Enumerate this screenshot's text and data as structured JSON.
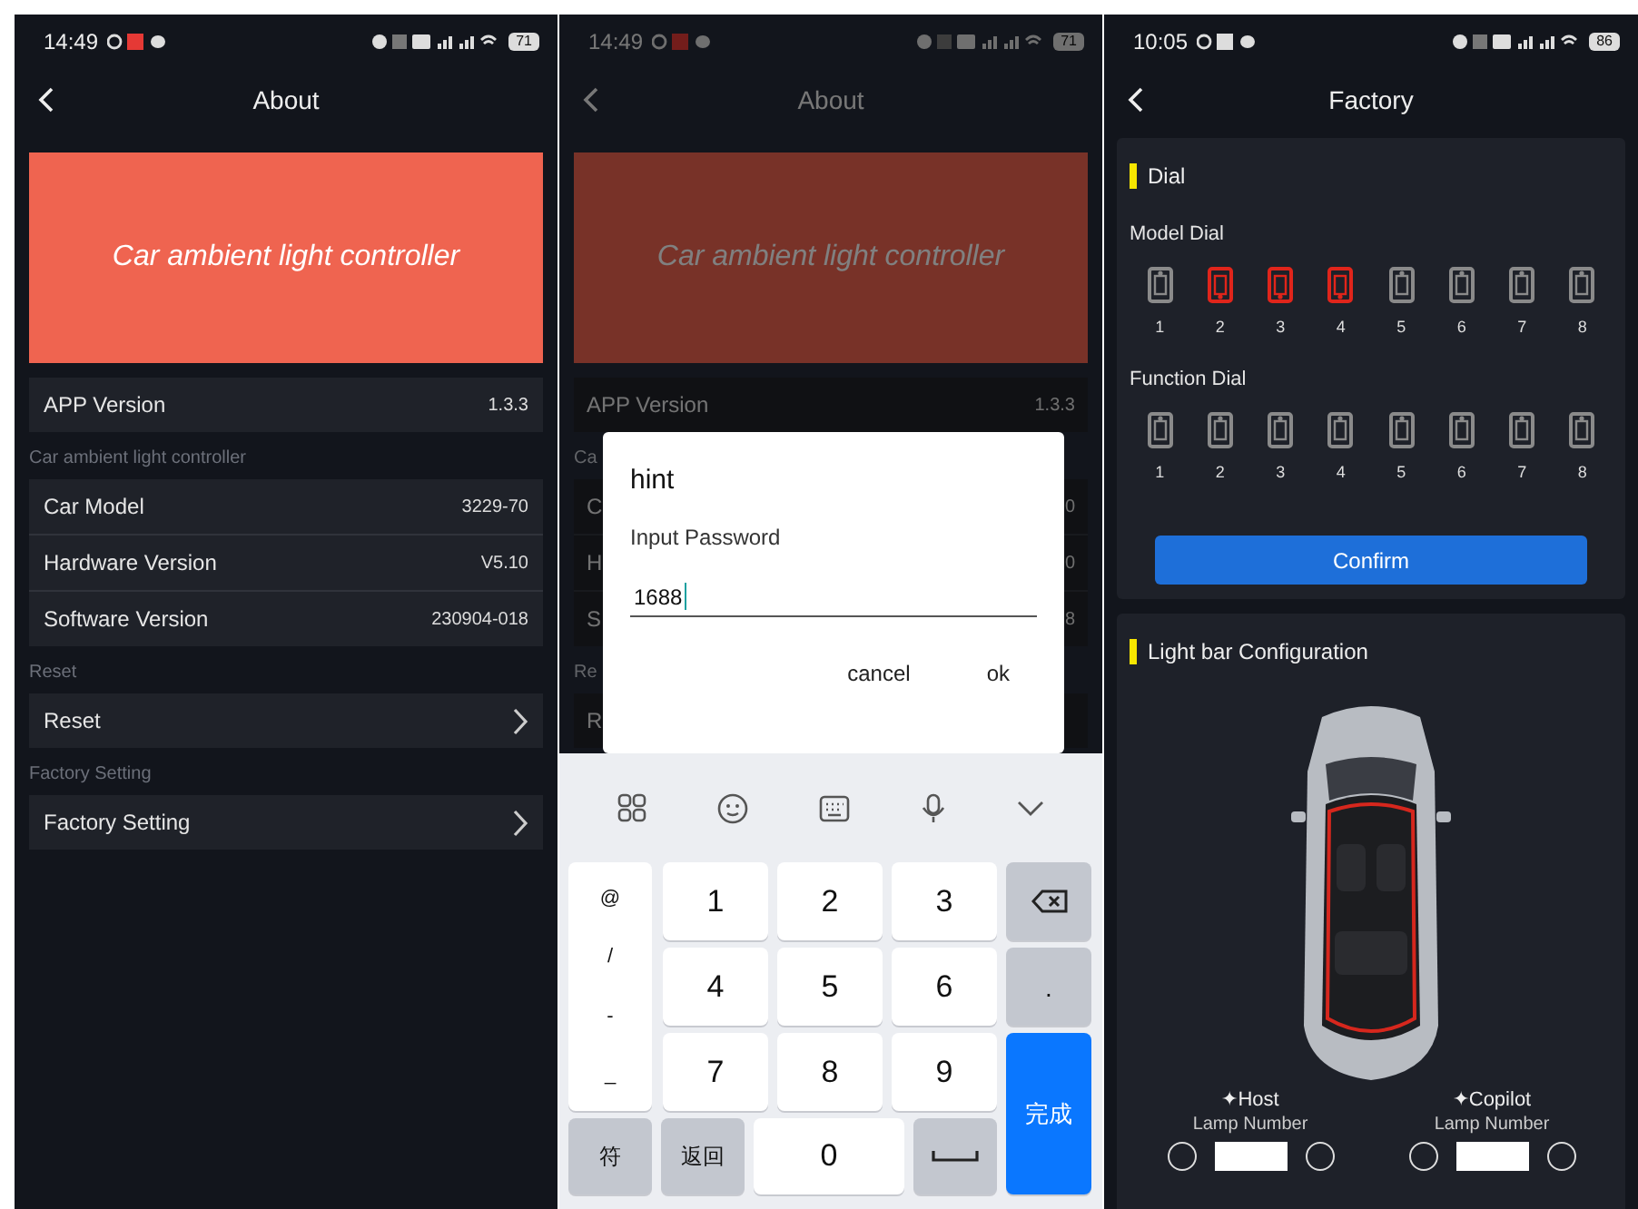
{
  "screens": [
    {
      "kind": "about",
      "status_bar": {
        "time": "14:49",
        "battery": "71"
      },
      "header": {
        "title": "About"
      },
      "banner": {
        "text": "Car ambient light controller"
      },
      "sections": [
        {
          "rows": [
            {
              "kind": "info",
              "label": "APP Version",
              "value": "1.3.3"
            }
          ]
        },
        {
          "heading": "Car ambient light controller",
          "rows": [
            {
              "kind": "info",
              "label": "Car Model",
              "value": "3229-70"
            },
            {
              "kind": "info",
              "label": "Hardware Version",
              "value": "V5.10"
            },
            {
              "kind": "info",
              "label": "Software Version",
              "value": "230904-018"
            }
          ]
        },
        {
          "heading": "Reset",
          "rows": [
            {
              "kind": "link",
              "label": "Reset"
            }
          ]
        },
        {
          "heading": "Factory Setting",
          "rows": [
            {
              "kind": "link",
              "label": "Factory Setting"
            }
          ]
        }
      ]
    },
    {
      "kind": "password",
      "status_bar": {
        "time": "14:49",
        "battery": "71"
      },
      "header": {
        "title": "About"
      },
      "banner": {
        "text": "Car ambient light controller"
      },
      "sections": [
        {
          "rows": [
            {
              "kind": "info",
              "label": "APP Version",
              "value": "1.3.3"
            }
          ]
        },
        {
          "heading": "Ca",
          "rows": [
            {
              "kind": "info",
              "label": "C",
              "value": "0"
            },
            {
              "kind": "info",
              "label": "H",
              "value": "0"
            },
            {
              "kind": "info",
              "label": "S",
              "value": "8"
            }
          ]
        },
        {
          "heading": "Re",
          "rows": [
            {
              "kind": "info",
              "label": "R"
            }
          ]
        }
      ],
      "dialog": {
        "title": "hint",
        "message": "Input Password",
        "value": "1688",
        "buttons": [
          "cancel",
          "ok"
        ]
      },
      "keyboard": {
        "side_keys": [
          "@",
          "/",
          "-",
          "_"
        ],
        "digits": [
          "1",
          "2",
          "3",
          "4",
          "5",
          "6",
          "7",
          "8",
          "9"
        ],
        "dot": ".",
        "bottom_keys": [
          "符",
          "返回",
          "0"
        ],
        "done": "完成"
      }
    },
    {
      "kind": "factory",
      "status_bar": {
        "time": "10:05",
        "battery": "86"
      },
      "header": {
        "title": "Factory"
      },
      "dial_card": {
        "title": "Dial",
        "groups": [
          {
            "label": "Model Dial",
            "switches": [
              {
                "label": "1",
                "on": false
              },
              {
                "label": "2",
                "on": true
              },
              {
                "label": "3",
                "on": true
              },
              {
                "label": "4",
                "on": true
              },
              {
                "label": "5",
                "on": false
              },
              {
                "label": "6",
                "on": false
              },
              {
                "label": "7",
                "on": false
              },
              {
                "label": "8",
                "on": false
              }
            ]
          },
          {
            "label": "Function Dial",
            "switches": [
              {
                "label": "1",
                "on": false
              },
              {
                "label": "2",
                "on": false
              },
              {
                "label": "3",
                "on": false
              },
              {
                "label": "4",
                "on": false
              },
              {
                "label": "5",
                "on": false
              },
              {
                "label": "6",
                "on": false
              },
              {
                "label": "7",
                "on": false
              },
              {
                "label": "8",
                "on": false
              }
            ]
          }
        ],
        "button": "Confirm"
      },
      "light_card": {
        "title": "Light bar Configuration",
        "sides": [
          {
            "label": "✦Host",
            "field_label": "Lamp Number"
          },
          {
            "label": "✦Copilot",
            "field_label": "Lamp Number"
          }
        ]
      }
    }
  ]
}
